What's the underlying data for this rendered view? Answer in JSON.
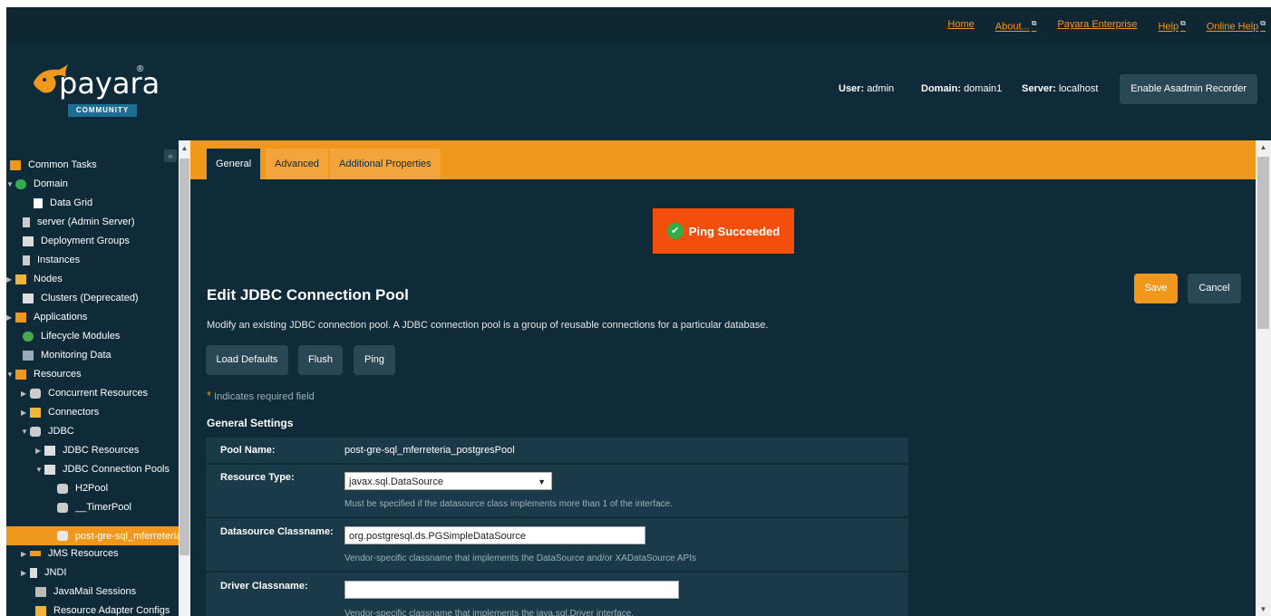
{
  "topnav": {
    "links": [
      {
        "label": "Home",
        "ext": ""
      },
      {
        "label": "About...",
        "ext": "⧉"
      },
      {
        "label": "Payara Enterprise",
        "ext": ""
      },
      {
        "label": "Help",
        "ext": "⧉"
      },
      {
        "label": "Online Help",
        "ext": "⧉"
      }
    ]
  },
  "header": {
    "logo_text": "payara",
    "logo_reg": "®",
    "logo_badge": "COMMUNITY",
    "user_label": "User:",
    "user_value": "admin",
    "domain_label": "Domain:",
    "domain_value": "domain1",
    "server_label": "Server:",
    "server_value": "localhost",
    "recorder_button": "Enable Asadmin Recorder"
  },
  "sidebar": {
    "collapse_icon": "«",
    "items": [
      {
        "label": "Common Tasks",
        "icon": "tasks-icon",
        "arrow": ""
      },
      {
        "label": "Domain",
        "icon": "domain-icon",
        "arrow": "▼"
      },
      {
        "label": "Data Grid",
        "icon": "data-grid-icon",
        "arrow": ""
      },
      {
        "label": "server (Admin Server)",
        "icon": "server-icon",
        "arrow": ""
      },
      {
        "label": "Deployment Groups",
        "icon": "deployment-groups-icon",
        "arrow": ""
      },
      {
        "label": "Instances",
        "icon": "instances-icon",
        "arrow": ""
      },
      {
        "label": "Nodes",
        "icon": "nodes-icon",
        "arrow": "▶"
      },
      {
        "label": "Clusters (Deprecated)",
        "icon": "clusters-icon",
        "arrow": ""
      },
      {
        "label": "Applications",
        "icon": "applications-icon",
        "arrow": "▶"
      },
      {
        "label": "Lifecycle Modules",
        "icon": "lifecycle-icon",
        "arrow": ""
      },
      {
        "label": "Monitoring Data",
        "icon": "monitoring-icon",
        "arrow": ""
      },
      {
        "label": "Resources",
        "icon": "resources-icon",
        "arrow": "▼"
      },
      {
        "label": "Concurrent Resources",
        "icon": "database-icon",
        "arrow": "▶"
      },
      {
        "label": "Connectors",
        "icon": "connectors-icon",
        "arrow": "▶"
      },
      {
        "label": "JDBC",
        "icon": "database-icon",
        "arrow": "▼"
      },
      {
        "label": "JDBC Resources",
        "icon": "folder-icon",
        "arrow": "▶"
      },
      {
        "label": "JDBC Connection Pools",
        "icon": "folder-icon",
        "arrow": "▼"
      },
      {
        "label": "H2Pool",
        "icon": "database-icon",
        "arrow": ""
      },
      {
        "label": "__TimerPool",
        "icon": "database-icon",
        "arrow": ""
      },
      {
        "label": "post-gre-sql_mferreteria",
        "icon": "database-icon",
        "arrow": ""
      },
      {
        "label": "JMS Resources",
        "icon": "jms-icon",
        "arrow": "▶"
      },
      {
        "label": "JNDI",
        "icon": "jndi-icon",
        "arrow": "▶"
      },
      {
        "label": "JavaMail Sessions",
        "icon": "mail-icon",
        "arrow": ""
      },
      {
        "label": "Resource Adapter Configs",
        "icon": "connectors-icon",
        "arrow": ""
      }
    ]
  },
  "tabs": [
    {
      "label": "General"
    },
    {
      "label": "Advanced"
    },
    {
      "label": "Additional Properties"
    }
  ],
  "alert": {
    "message": "Ping Succeeded",
    "icon": "✔"
  },
  "page": {
    "title": "Edit JDBC Connection Pool",
    "description": "Modify an existing JDBC connection pool. A JDBC connection pool is a group of reusable connections for a particular database.",
    "save_label": "Save",
    "cancel_label": "Cancel",
    "load_defaults_label": "Load Defaults",
    "flush_label": "Flush",
    "ping_label": "Ping",
    "required_star": "*",
    "required_note": "Indicates required field",
    "section_title": "General Settings"
  },
  "properties": {
    "pool_name_label": "Pool Name:",
    "pool_name_value": "post-gre-sql_mferreteria_postgresPool",
    "resource_type_label": "Resource Type:",
    "resource_type_value": "javax.sql.DataSource",
    "resource_type_help": "Must be specified if the datasource class implements more than 1 of the interface.",
    "datasource_label": "Datasource Classname:",
    "datasource_value": "org.postgresql.ds.PGSimpleDataSource",
    "datasource_help": "Vendor-specific classname that implements the DataSource and/or XADataSource APIs",
    "driver_label": "Driver Classname:",
    "driver_value": "",
    "driver_help": "Vendor-specific classname that implements the java.sql.Driver interface."
  },
  "colors": {
    "accent": "#f0981b",
    "background": "#0f2b39",
    "alert": "#f34e0c"
  }
}
